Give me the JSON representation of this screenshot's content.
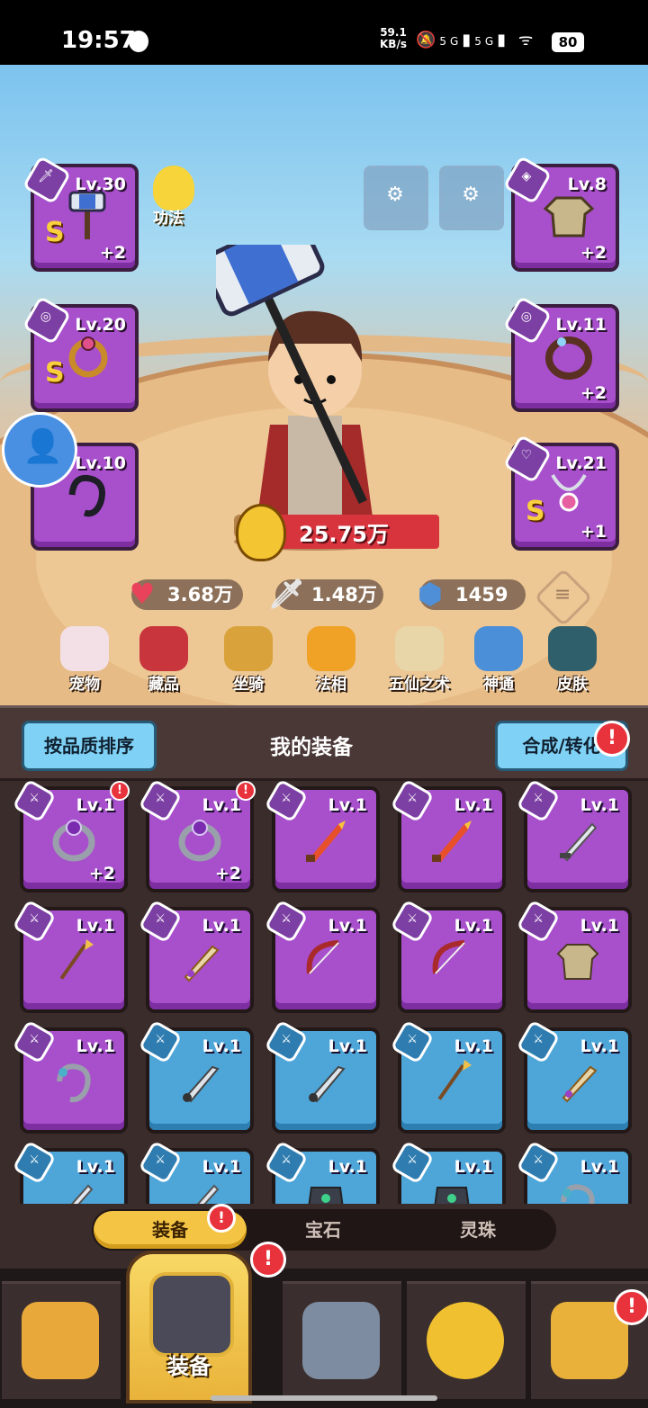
{
  "status_bar": {
    "time": "19:57",
    "net_speed": "59.1",
    "net_unit": "KB/s",
    "signal1": "5G",
    "signal2": "5G",
    "battery": "80"
  },
  "equipped": {
    "weapon": {
      "level": "Lv.30",
      "grade": "S",
      "plus": "+2"
    },
    "amulet_left": {
      "level": "Lv.20",
      "grade": "S"
    },
    "bracelet": {
      "level": "Lv.10"
    },
    "armor": {
      "level": "Lv.8",
      "plus": "+2"
    },
    "ring": {
      "level": "Lv.11",
      "plus": "+2"
    },
    "necklace": {
      "level": "Lv.21",
      "grade": "S",
      "plus": "+1"
    }
  },
  "kungfu_label": "功法",
  "power": "25.75万",
  "stats": {
    "hp": "3.68万",
    "atk": "1.48万",
    "def": "1459"
  },
  "features": [
    "宠物",
    "藏品",
    "坐骑",
    "法相",
    "五仙之术",
    "神通",
    "皮肤"
  ],
  "panel": {
    "sort_label": "按品质排序",
    "title": "我的装备",
    "synth_label": "合成/转化"
  },
  "inventory": [
    {
      "rarity": "purple",
      "icon": "ring",
      "level": "Lv.1",
      "plus": "+2",
      "alert": true
    },
    {
      "rarity": "purple",
      "icon": "ring",
      "level": "Lv.1",
      "plus": "+2",
      "alert": true
    },
    {
      "rarity": "purple",
      "icon": "flame-sword",
      "level": "Lv.1"
    },
    {
      "rarity": "purple",
      "icon": "flame-sword",
      "level": "Lv.1"
    },
    {
      "rarity": "purple",
      "icon": "sword",
      "level": "Lv.1"
    },
    {
      "rarity": "purple",
      "icon": "spear",
      "level": "Lv.1"
    },
    {
      "rarity": "purple",
      "icon": "golden-sword",
      "level": "Lv.1"
    },
    {
      "rarity": "purple",
      "icon": "bow",
      "level": "Lv.1"
    },
    {
      "rarity": "purple",
      "icon": "bow",
      "level": "Lv.1"
    },
    {
      "rarity": "purple",
      "icon": "tunic",
      "level": "Lv.1"
    },
    {
      "rarity": "purple",
      "icon": "bracelet",
      "level": "Lv.1"
    },
    {
      "rarity": "blue",
      "icon": "sickle-sword",
      "level": "Lv.1"
    },
    {
      "rarity": "blue",
      "icon": "sickle-sword",
      "level": "Lv.1"
    },
    {
      "rarity": "blue",
      "icon": "spear",
      "level": "Lv.1"
    },
    {
      "rarity": "blue",
      "icon": "golden-sword",
      "level": "Lv.1"
    },
    {
      "rarity": "blue",
      "icon": "sword",
      "level": "Lv.1"
    },
    {
      "rarity": "blue",
      "icon": "sword",
      "level": "Lv.1"
    },
    {
      "rarity": "blue",
      "icon": "armor",
      "level": "Lv.1"
    },
    {
      "rarity": "blue",
      "icon": "armor",
      "level": "Lv.1"
    },
    {
      "rarity": "blue",
      "icon": "bracelet",
      "level": "Lv.1"
    }
  ],
  "tabs": [
    "装备",
    "宝石",
    "灵珠"
  ],
  "bottom_nav": {
    "active_label": "装备"
  },
  "colors": {
    "purple_rarity": "#a84fcc",
    "blue_rarity": "#4da5d8",
    "accent_gold": "#f4c544",
    "alert_red": "#e8333c"
  }
}
